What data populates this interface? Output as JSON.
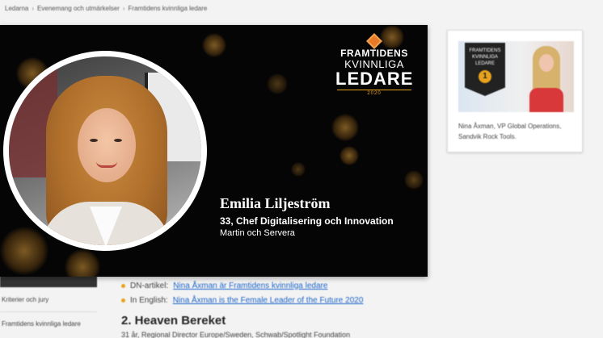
{
  "breadcrumb": [
    "Ledarna",
    "Evenemang och utmärkelser",
    "Framtidens kvinnliga ledare"
  ],
  "banner": {
    "logo": {
      "line1": "FRAMTIDENS",
      "line2": "KVINNLIGA",
      "line3": "LEDARE",
      "year": "2020"
    },
    "person_name": "Emilia Liljeström",
    "role": "33, Chef Digitalisering och Innovation",
    "company": "Martin och Servera"
  },
  "side_menu": [
    "",
    "Kriterier och jury",
    "Framtidens kvinnliga ledare"
  ],
  "content": {
    "links": [
      {
        "prefix": "DN-artikel:",
        "link": "Nina Åxman är Framtidens kvinnliga ledare"
      },
      {
        "prefix": "In English:",
        "link": "Nina Åxman is the Female Leader of the Future 2020"
      }
    ],
    "heading": "2. Heaven Bereket",
    "subtext": "31 år, Regional Director Europe/Sweden, Schwab/Spotlight Foundation"
  },
  "side_card": {
    "badge_line1": "FRAMTIDENS",
    "badge_line2": "KVINNLIGA",
    "badge_line3": "LEDARE",
    "badge_number": "1",
    "caption": "Nina Åxman, VP Global Operations, Sandvik Rock Tools."
  },
  "colors": {
    "accent": "#e8a21b",
    "link": "#1e66c8",
    "banner_bg": "#050505"
  }
}
